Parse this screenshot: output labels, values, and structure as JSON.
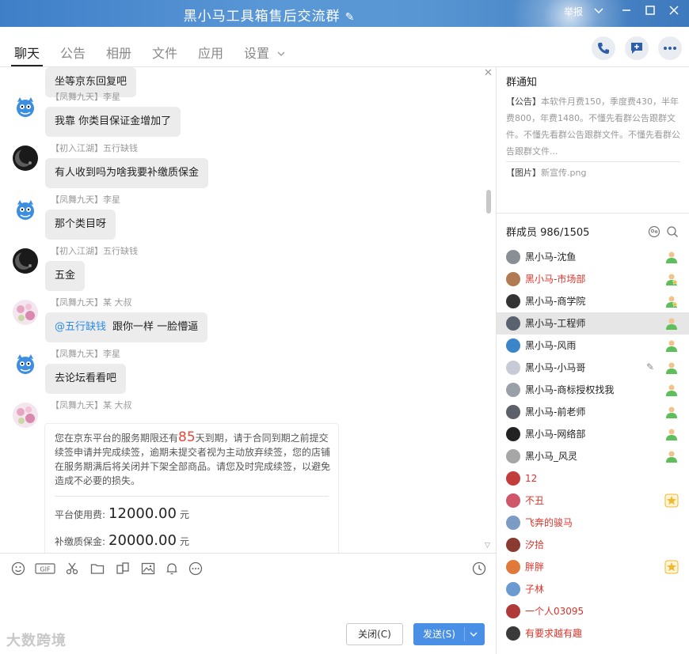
{
  "window": {
    "title": "黑小马工具箱售后交流群",
    "report_label": "举报"
  },
  "tabs": [
    "聊天",
    "公告",
    "相册",
    "文件",
    "应用",
    "设置"
  ],
  "messages": [
    {
      "sender": "",
      "text": "坐等京东回复吧",
      "avatar": "partial"
    },
    {
      "sender": "【凤舞九天】李星",
      "text": "我靠 你类目保证金增加了",
      "avatar": "blue-cat"
    },
    {
      "sender": "【初入江湖】五行缺钱",
      "text": "有人收到吗为啥我要补缴质保金",
      "avatar": "dark-moon"
    },
    {
      "sender": "【凤舞九天】李星",
      "text": "那个类目呀",
      "avatar": "blue-cat"
    },
    {
      "sender": "【初入江湖】五行缺钱",
      "text": "五金",
      "avatar": "dark-moon"
    },
    {
      "sender": "【凤舞九天】某 大叔",
      "mention": "@五行缺钱",
      "text": "跟你一样  一脸懵逼",
      "avatar": "pink-flower"
    },
    {
      "sender": "【凤舞九天】李星",
      "text": "去论坛看看吧",
      "avatar": "blue-cat"
    },
    {
      "sender": "【凤舞九天】某 大叔",
      "avatar": "pink-flower"
    }
  ],
  "card": {
    "notice_before": "您在京东平台的服务期限还有",
    "days": "85",
    "notice_after": "天到期，请于合同到期之前提交续签申请并完成续签，逾期未提交者视为主动放弃续签，您的店铺在服务期满后将关闭并下架全部商品。请您及时完成续签，以避免造成不必要的损失。",
    "fees": [
      {
        "label": "平台使用费:",
        "amount": "12000.00",
        "unit": "元"
      },
      {
        "label": "补缴质保金:",
        "amount": "20000.00",
        "unit": "元"
      }
    ]
  },
  "input": {
    "close_label": "关闭(C)",
    "send_label": "发送(S)",
    "watermark": "大数跨境"
  },
  "notice_panel": {
    "title": "群通知",
    "announcement_lead": "【公告】",
    "announcement_text": "本软件月费150，季度费430，半年费800，年费1480。不懂先看群公告跟群文件。不懂先看群公告跟群文件。不懂先看群公告跟群文件...",
    "image_lead": "【图片】",
    "image_text": "新宣传.png"
  },
  "members": {
    "header": "群成员 986/1505",
    "list": [
      {
        "name": "黑小马-沈鱼",
        "red": false,
        "badge": "admin",
        "avatar_color": "#8a8f96"
      },
      {
        "name": "黑小马-市场部",
        "red": true,
        "badge": "admin-star",
        "avatar_color": "#b07a52"
      },
      {
        "name": "黑小马-商学院",
        "red": false,
        "badge": "admin-star",
        "avatar_color": "#333333"
      },
      {
        "name": "黑小马-工程师",
        "red": false,
        "badge": "admin",
        "avatar_color": "#5a6270",
        "selected": true
      },
      {
        "name": "黑小马-风雨",
        "red": false,
        "badge": "admin",
        "avatar_color": "#3a86c8"
      },
      {
        "name": "黑小马-小马哥",
        "red": false,
        "badge": "admin",
        "avatar_color": "#c7cbd6",
        "edit": true
      },
      {
        "name": "黑小马-商标授权找我",
        "red": false,
        "badge": "admin",
        "avatar_color": "#9aa0a8"
      },
      {
        "name": "黑小马-前老师",
        "red": false,
        "badge": "admin",
        "avatar_color": "#5d6068"
      },
      {
        "name": "黑小马-网络部",
        "red": false,
        "badge": "admin",
        "avatar_color": "#222222"
      },
      {
        "name": "黑小马_风灵",
        "red": false,
        "badge": "admin",
        "avatar_color": "#a6a6a6"
      },
      {
        "name": "12",
        "red": true,
        "badge": "",
        "avatar_color": "#c43d3d"
      },
      {
        "name": "不丑",
        "red": true,
        "badge": "star",
        "avatar_color": "#d0566a"
      },
      {
        "name": "飞奔的骏马",
        "red": true,
        "badge": "",
        "avatar_color": "#7d9cc4"
      },
      {
        "name": "汐拾",
        "red": true,
        "badge": "",
        "avatar_color": "#8a3a30"
      },
      {
        "name": "胖胖",
        "red": true,
        "badge": "star",
        "avatar_color": "#e07a3a"
      },
      {
        "name": "子林",
        "red": true,
        "badge": "",
        "avatar_color": "#6a9ad0"
      },
      {
        "name": "一个人03095",
        "red": true,
        "badge": "",
        "avatar_color": "#b03a3a"
      },
      {
        "name": "有要求越有趣",
        "red": true,
        "badge": "",
        "avatar_color": "#3a3a3a"
      }
    ]
  }
}
